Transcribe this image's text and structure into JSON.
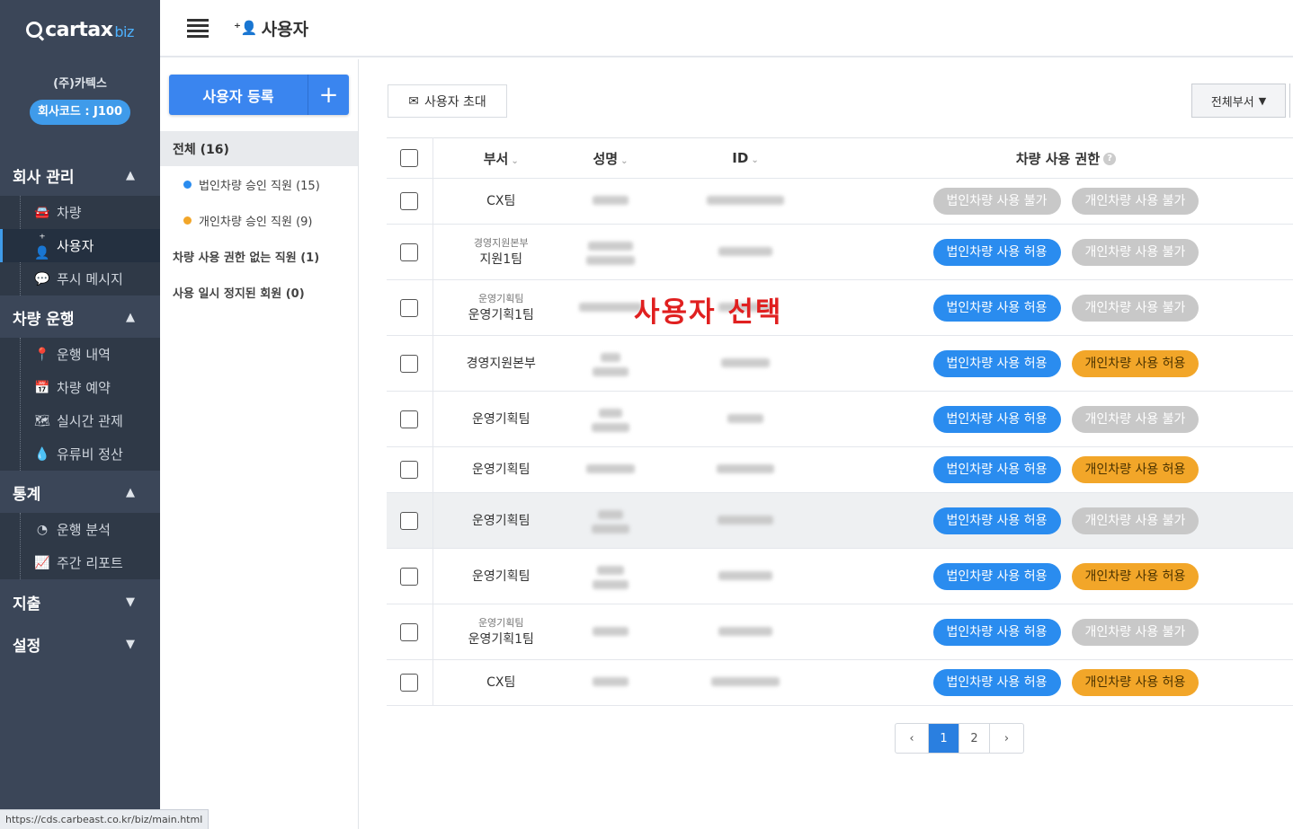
{
  "logo": {
    "main": "cartax",
    "suffix": "biz"
  },
  "company": {
    "name": "(주)카텍스",
    "code": "회사코드 : J100"
  },
  "sidebar": {
    "groups": [
      {
        "label": "회사 관리",
        "items": [
          {
            "label": "차량",
            "icon": "car-icon"
          },
          {
            "label": "사용자",
            "icon": "user-add-icon"
          },
          {
            "label": "푸시 메시지",
            "icon": "chat-icon"
          }
        ]
      },
      {
        "label": "차량 운행",
        "items": [
          {
            "label": "운행 내역",
            "icon": "map-pin-icon"
          },
          {
            "label": "차량 예약",
            "icon": "calendar-icon"
          },
          {
            "label": "실시간 관제",
            "icon": "map-icon"
          },
          {
            "label": "유류비 정산",
            "icon": "drop-icon"
          }
        ]
      },
      {
        "label": "통계",
        "items": [
          {
            "label": "운행 분석",
            "icon": "pie-chart-icon"
          },
          {
            "label": "주간 리포트",
            "icon": "area-chart-icon"
          }
        ]
      },
      {
        "label": "지출"
      },
      {
        "label": "설정"
      }
    ]
  },
  "header": {
    "title": "사용자"
  },
  "filters": {
    "register_label": "사용자 등록",
    "all": "전체 (16)",
    "corp_approved": "법인차량 승인 직원 (15)",
    "personal_approved": "개인차량 승인 직원 (9)",
    "no_permission": "차량 사용 권한 없는 직원 (1)",
    "suspended": "사용 일시 정지된 회원 (0)",
    "colors": {
      "corp": "#2a8cef",
      "personal": "#f2a629"
    }
  },
  "toolbar": {
    "invite_label": "사용자 초대",
    "dept_select": "전체부서"
  },
  "table": {
    "headers": {
      "dept": "부서",
      "name": "성명",
      "id": "ID",
      "permission": "차량 사용 권한"
    },
    "rows": [
      {
        "dept_top": "",
        "dept": "CX팀",
        "corp": "법인차량 사용 불가",
        "corp_allowed": false,
        "personal": "개인차량 사용 불가",
        "personal_allowed": false
      },
      {
        "dept_top": "경영지원본부",
        "dept": "지원1팀",
        "corp": "법인차량 사용 허용",
        "corp_allowed": true,
        "personal": "개인차량 사용 불가",
        "personal_allowed": false
      },
      {
        "dept_top": "운영기획팀",
        "dept": "운영기획1팀",
        "corp": "법인차량 사용 허용",
        "corp_allowed": true,
        "personal": "개인차량 사용 불가",
        "personal_allowed": false
      },
      {
        "dept_top": "",
        "dept": "경영지원본부",
        "corp": "법인차량 사용 허용",
        "corp_allowed": true,
        "personal": "개인차량 사용 허용",
        "personal_allowed": true
      },
      {
        "dept_top": "",
        "dept": "운영기획팀",
        "corp": "법인차량 사용 허용",
        "corp_allowed": true,
        "personal": "개인차량 사용 불가",
        "personal_allowed": false
      },
      {
        "dept_top": "",
        "dept": "운영기획팀",
        "corp": "법인차량 사용 허용",
        "corp_allowed": true,
        "personal": "개인차량 사용 허용",
        "personal_allowed": true
      },
      {
        "dept_top": "",
        "dept": "운영기획팀",
        "corp": "법인차량 사용 허용",
        "corp_allowed": true,
        "personal": "개인차량 사용 불가",
        "personal_allowed": false
      },
      {
        "dept_top": "",
        "dept": "운영기획팀",
        "corp": "법인차량 사용 허용",
        "corp_allowed": true,
        "personal": "개인차량 사용 허용",
        "personal_allowed": true
      },
      {
        "dept_top": "운영기획팀",
        "dept": "운영기획1팀",
        "corp": "법인차량 사용 허용",
        "corp_allowed": true,
        "personal": "개인차량 사용 불가",
        "personal_allowed": false
      },
      {
        "dept_top": "",
        "dept": "CX팀",
        "corp": "법인차량 사용 허용",
        "corp_allowed": true,
        "personal": "개인차량 사용 허용",
        "personal_allowed": true
      }
    ]
  },
  "annotation": "사용자 선택",
  "pagination": {
    "prev": "‹",
    "pages": [
      "1",
      "2"
    ],
    "current": "1",
    "next": "›"
  },
  "status_url": "https://cds.carbeast.co.kr/biz/main.html"
}
